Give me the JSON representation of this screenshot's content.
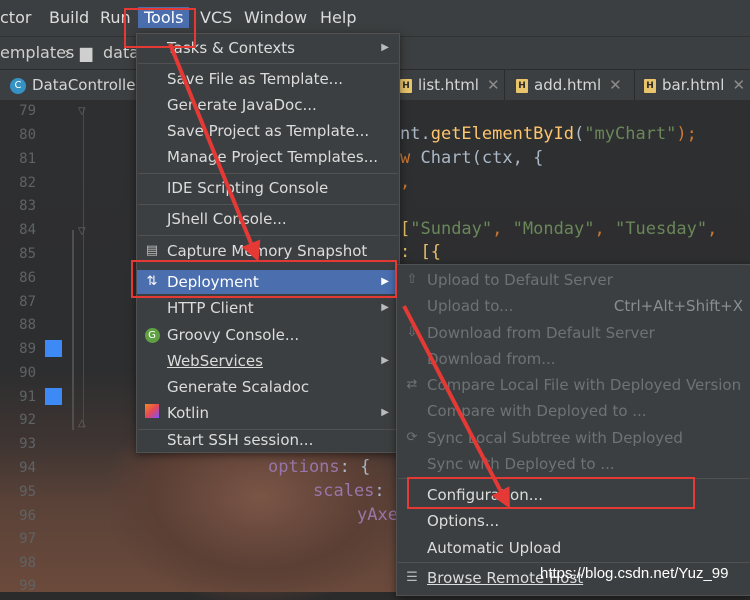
{
  "menubar": {
    "items": [
      "ctor",
      "Build",
      "Run",
      "Tools",
      "VCS",
      "Window",
      "Help"
    ],
    "active": "Tools"
  },
  "breadcrumb": {
    "part1": "emplates",
    "sep": "›",
    "part2": "data"
  },
  "tabs": [
    {
      "label": "DataController",
      "icon": "C"
    },
    {
      "label": "list.html",
      "icon": "H"
    },
    {
      "label": "add.html",
      "icon": "H"
    },
    {
      "label": "bar.html",
      "icon": "H"
    }
  ],
  "gutter": {
    "lines": [
      "79",
      "80",
      "81",
      "82",
      "83",
      "84",
      "85",
      "86",
      "87",
      "88",
      "89",
      "90",
      "91",
      "92",
      "93",
      "94",
      "95",
      "96",
      "97",
      "98",
      "99"
    ]
  },
  "code": {
    "l80a": "nt.",
    "l80b": "getElementById",
    "l80c": "(",
    "l80d": "\"myChart\"",
    "l80e": ");",
    "l81a": "w ",
    "l81b": "Chart(ctx, {",
    "l82": ",",
    "l84a": "[",
    "l84b": "\"Sunday\"",
    "l84c": ", ",
    "l84d": "\"Monday\"",
    "l84e": ", ",
    "l84f": "\"Tuesday\"",
    "l84g": ",",
    "l85": ": [{",
    "l94a": "options",
    "l94b": ": {",
    "l95a": "scales",
    "l95b": ":",
    "l96": "yAxe"
  },
  "tools_menu": {
    "items": [
      {
        "label": "Tasks & Contexts",
        "submenu": true
      },
      {
        "label": "Save File as Template..."
      },
      {
        "label": "Generate JavaDoc..."
      },
      {
        "label": "Save Project as Template..."
      },
      {
        "label": "Manage Project Templates..."
      },
      {
        "label": "IDE Scripting Console"
      },
      {
        "label": "JShell Console..."
      },
      {
        "label": "Capture Memory Snapshot",
        "icon": "memory-snapshot-icon"
      },
      {
        "label": "Deployment",
        "icon": "deployment-icon",
        "submenu": true,
        "selected": true
      },
      {
        "label": "HTTP Client",
        "submenu": true
      },
      {
        "label": "Groovy Console...",
        "icon": "groovy-icon"
      },
      {
        "label": "WebServices",
        "submenu": true
      },
      {
        "label": "Generate Scaladoc"
      },
      {
        "label": "Kotlin",
        "icon": "kotlin-icon",
        "submenu": true
      },
      {
        "label": "Start SSH session..."
      }
    ]
  },
  "deployment_menu": {
    "items": [
      {
        "label": "Upload to Default Server",
        "enabled": false,
        "icon": "upload-icon"
      },
      {
        "label": "Upload to...",
        "shortcut": "Ctrl+Alt+Shift+X",
        "enabled": false
      },
      {
        "label": "Download from Default Server",
        "enabled": false,
        "icon": "download-icon"
      },
      {
        "label": "Download from...",
        "enabled": false
      },
      {
        "label": "Compare Local File with Deployed Version",
        "enabled": false,
        "icon": "compare-icon"
      },
      {
        "label": "Compare with Deployed to ...",
        "enabled": false
      },
      {
        "label": "Sync Local Subtree with Deployed",
        "enabled": false,
        "icon": "sync-icon"
      },
      {
        "label": "Sync with Deployed to ...",
        "enabled": false
      },
      {
        "label": "Configuration...",
        "enabled": true
      },
      {
        "label": "Options...",
        "enabled": true
      },
      {
        "label": "Automatic Upload",
        "enabled": true
      },
      {
        "label": "Browse Remote Host",
        "enabled": true,
        "icon": "browse-icon"
      }
    ]
  },
  "watermark": "https://blog.csdn.net/Yuz_99",
  "colors": {
    "accent": "#4b6eaf",
    "annotation": "#e53935",
    "bookmark": "#3d8af7"
  }
}
